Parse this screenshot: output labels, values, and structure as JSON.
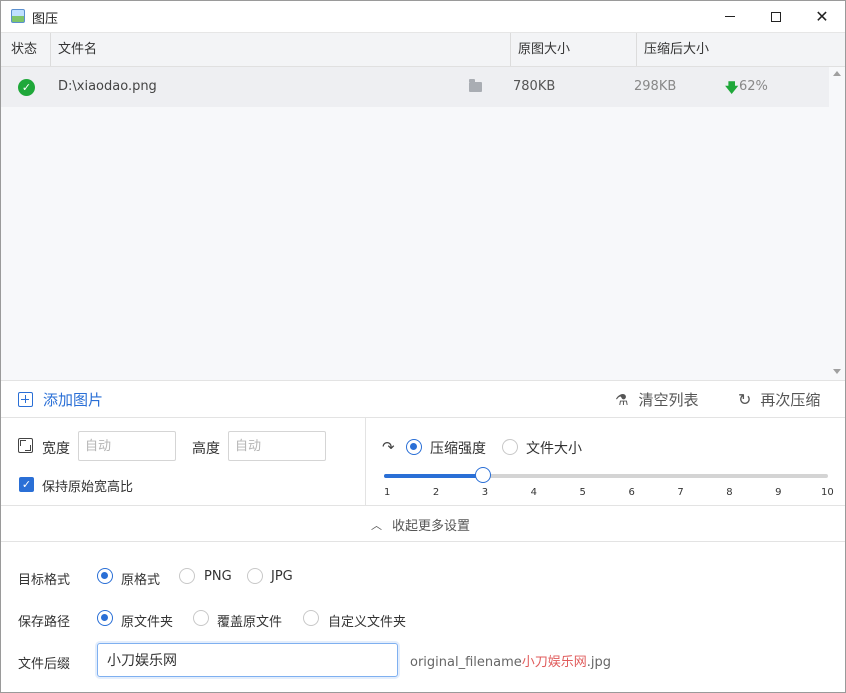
{
  "window": {
    "title": "图压",
    "close_glyph": "✕"
  },
  "table": {
    "headers": {
      "status": "状态",
      "filename": "文件名",
      "original_size": "原图大小",
      "compressed_size": "压缩后大小"
    },
    "rows": [
      {
        "status": "done",
        "filename": "D:\\xiaodao.png",
        "original_size": "780KB",
        "compressed_size": "298KB",
        "reduction": "62%"
      }
    ]
  },
  "toolbar": {
    "add_label": "添加图片",
    "clear_label": "清空列表",
    "recompress_label": "再次压缩"
  },
  "resize": {
    "width_label": "宽度",
    "width_placeholder": "自动",
    "height_label": "高度",
    "height_placeholder": "自动",
    "keep_ratio_label": "保持原始宽高比",
    "keep_ratio_checked": true
  },
  "compression": {
    "mode_strength_label": "压缩强度",
    "mode_size_label": "文件大小",
    "selected_mode": "strength",
    "slider": {
      "min": 1,
      "max": 10,
      "value": 3,
      "ticks": [
        "1",
        "2",
        "3",
        "4",
        "5",
        "6",
        "7",
        "8",
        "9",
        "10"
      ]
    }
  },
  "collapse_label": "收起更多设置",
  "format": {
    "label": "目标格式",
    "options": [
      "原格式",
      "PNG",
      "JPG"
    ],
    "selected": "原格式"
  },
  "save_path": {
    "label": "保存路径",
    "options": [
      "原文件夹",
      "覆盖原文件",
      "自定义文件夹"
    ],
    "selected": "原文件夹"
  },
  "suffix": {
    "label": "文件后缀",
    "value": "小刀娱乐网",
    "preview_prefix": "original_filename",
    "preview_suffix": "小刀娱乐网",
    "preview_ext": ".jpg"
  },
  "colors": {
    "accent": "#2a6fd6",
    "success": "#1fa83a",
    "suffix_highlight": "#e05c5c"
  }
}
